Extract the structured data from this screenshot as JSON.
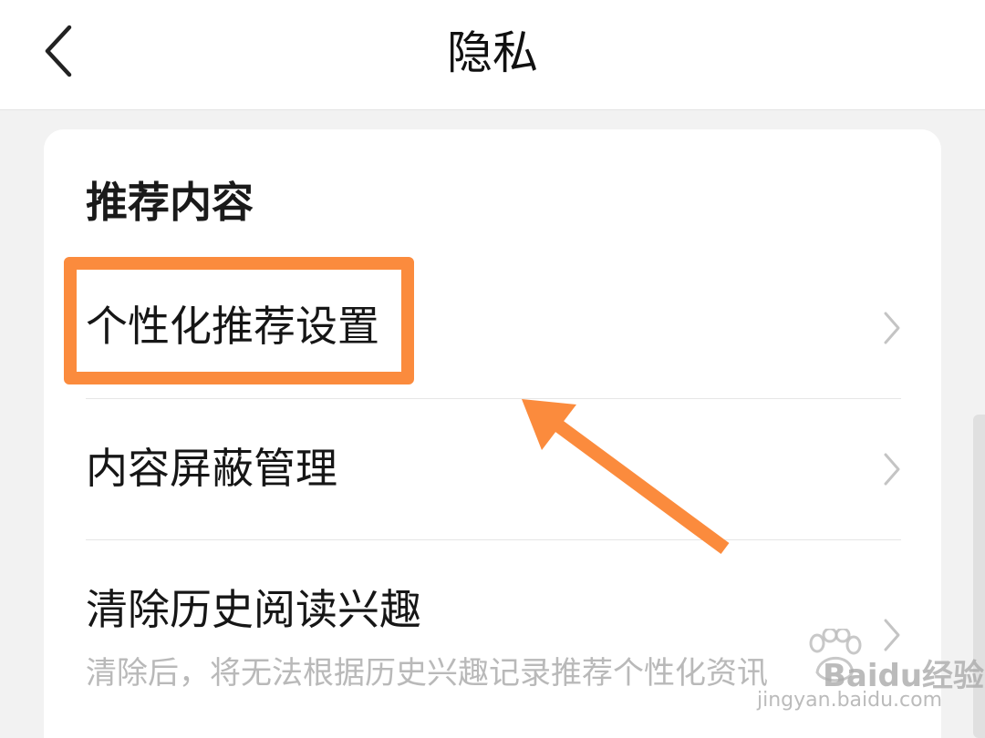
{
  "header": {
    "title": "隐私",
    "back_icon": "chevron-left-icon"
  },
  "section": {
    "title": "推荐内容"
  },
  "rows": [
    {
      "label": "个性化推荐设置",
      "chevron_icon": "chevron-right-icon"
    },
    {
      "label": "内容屏蔽管理",
      "chevron_icon": "chevron-right-icon"
    },
    {
      "label": "清除历史阅读兴趣",
      "sublabel": "清除后，将无法根据历史兴趣记录推荐个性化资讯",
      "chevron_icon": "chevron-right-icon"
    }
  ],
  "annotation": {
    "color": "#fb8b3d"
  },
  "watermark": {
    "brand": "Baidu经验",
    "url": "jingyan.baidu.com"
  }
}
